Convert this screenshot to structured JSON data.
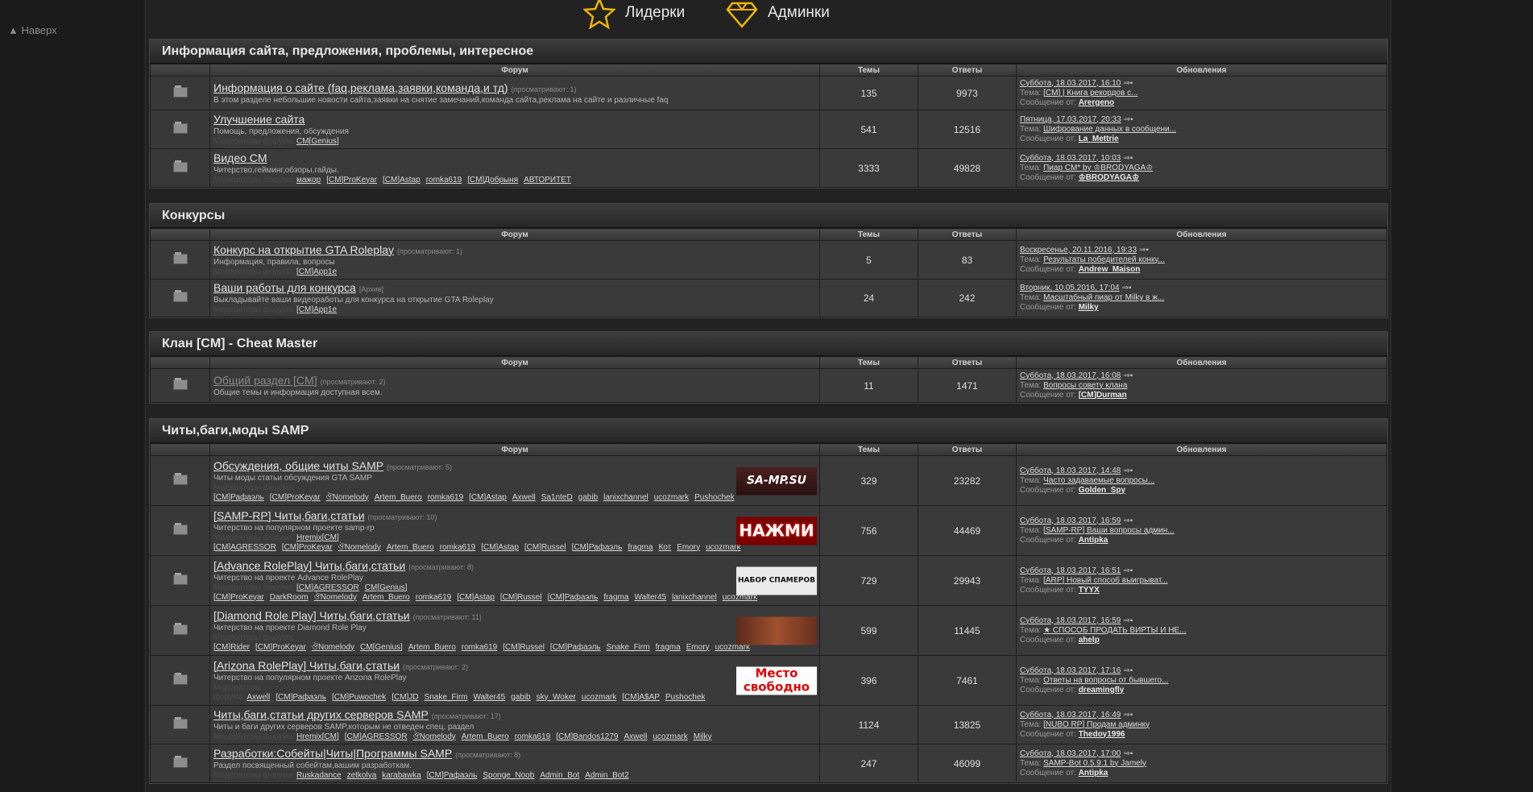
{
  "sidebar": {
    "back_to_top": "▲ Наверх"
  },
  "topnav": {
    "leaders": "Лидерки",
    "admins": "Админки"
  },
  "columns": {
    "forum": "Форум",
    "topics": "Темы",
    "replies": "Ответы",
    "updates": "Обновления"
  },
  "labels": {
    "topic": "Тема:",
    "message_from": "Сообщение от:",
    "moderators": "Модераторы форума:"
  },
  "categories": [
    {
      "title": "Информация сайта, предложения, проблемы, интересное",
      "forums": [
        {
          "title": "Информация о сайте (faq,реклама,заявки,команда,и тд)",
          "viewers": "(просматривают: 1)",
          "desc": "В этом разделе небольшие новости сайта,заявки на снятие замечаний,команда сайта,реклама на сайте и различные faq",
          "mods": [],
          "topics": "135",
          "replies": "9973",
          "date": "Суббота, 18.03.2017, 16:10",
          "topic": "[CM] | Книга рекордов с...",
          "user": "Arergeno"
        },
        {
          "title": "Улучшение сайта",
          "viewers": "",
          "desc": "Помощь, предложения, обсуждения",
          "mods": [
            "CM[Genius]"
          ],
          "topics": "541",
          "replies": "12516",
          "date": "Пятница, 17.03.2017, 20:33",
          "topic": "Шифрование данных в сообщени...",
          "user": "La_Mettrie"
        },
        {
          "title": "Видео CM",
          "viewers": "",
          "desc": "Читерство,гейминг,обзоры,гайды.",
          "mods": [
            "мажор",
            "[CM]ProKeyar",
            "[CM]Astap",
            "romka619",
            "[CM]Добрыня",
            "АВТОРИТЕТ"
          ],
          "topics": "3333",
          "replies": "49828",
          "date": "Суббота, 18.03.2017, 10:03",
          "topic": "Пиар CM* by ♔BRODYAGA♔",
          "user": "♔BRODYAGA♔"
        }
      ]
    },
    {
      "title": "Конкурсы",
      "forums": [
        {
          "title": "Конкурс на открытие GTA Roleplay",
          "viewers": "(просматривают: 1)",
          "desc": "Информация, правила, вопросы",
          "mods": [
            "[CM]App1e"
          ],
          "topics": "5",
          "replies": "83",
          "date": "Воскресенье, 20.11.2016, 19:33",
          "topic": "Результаты победителей конку...",
          "user": "Andrew_Maison"
        },
        {
          "title": "Ваши работы для конкурса",
          "viewers": "[Архив]",
          "desc": "Выкладывайте ваши видеоработы для конкурса на открытие GTA Roleplay",
          "mods": [
            "[CM]App1e"
          ],
          "topics": "24",
          "replies": "242",
          "date": "Вторник, 10.05.2016, 17:04",
          "topic": "Масштабный пиар от Milky в ж...",
          "user": "Milky"
        }
      ]
    },
    {
      "title": "Клан [CM] - Cheat Master",
      "forums": [
        {
          "title": "Общий раздел [CM]",
          "dim": true,
          "viewers": "(просматривают: 2)",
          "desc": "Общие темы и информация доступная всем.",
          "mods": [],
          "topics": "11",
          "replies": "1471",
          "date": "Суббота, 18.03.2017, 16:08",
          "topic": "Вопросы совету клана",
          "user": "[CM]Durman"
        }
      ]
    },
    {
      "title": "Читы,баги,моды SAMP",
      "forums": [
        {
          "title": "Обсуждения, общие читы SAMP",
          "viewers": "(просматривают: 5)",
          "desc": "Читы моды статьи обсуждения GTA SAMP",
          "mods": [
            "[CM]Рафаэль",
            "[CM]ProKeyar",
            "ঔNomelody",
            "Artem_Buero",
            "romka619",
            "[CM]Astap",
            "Axwell",
            "Sa1nteD",
            "gabib",
            "lanixchannel",
            "ucozmark",
            "Pushochek"
          ],
          "banner": "SA-MP.SU",
          "bclass": "b1",
          "topics": "329",
          "replies": "23282",
          "date": "Суббота, 18.03.2017, 14:48",
          "topic": "Часто задаваемые вопросы...",
          "user": "Golden_Spy"
        },
        {
          "title": "[SAMP-RP] Читы,баги,статьи",
          "viewers": "(просматривают: 10)",
          "desc": "Читерство на популярном проекте samp-rp",
          "mods": [
            "Hremix[CM]",
            "[CM]AGRESSOR",
            "[CM]ProKeyar",
            "ঔNomelody",
            "Artem_Buero",
            "romka619",
            "[CM]Astap",
            "[CM]Russel",
            "[CM]Рафаэль",
            "fragma",
            "Кот",
            "Emory",
            "ucozmark"
          ],
          "banner": "НАЖМИ",
          "bclass": "b2",
          "topics": "756",
          "replies": "44469",
          "date": "Суббота, 18.03.2017, 16:59",
          "topic": "[SAMP-RP] Ваши вопросы админ...",
          "user": "Antipka"
        },
        {
          "title": "[Advance RolePlay] Читы,баги,статьи",
          "viewers": "(просматривают: 8)",
          "desc": "Читерство на проекте Advance RolePlay",
          "mods": [
            "[CM]AGRESSOR",
            "CM[Genius]",
            "[CM]ProKeyar",
            "DarkRoom",
            "ঔNomelody",
            "Artem_Buero",
            "romka619",
            "[CM]Astap",
            "[CM]Russel",
            "[CM]Рафаэль",
            "fragma",
            "Walter45",
            "lanixchannel",
            "ucozmark"
          ],
          "banner": "НАБОР СПАМЕРОВ",
          "bclass": "b3",
          "topics": "729",
          "replies": "29943",
          "date": "Суббота, 18.03.2017, 16:51",
          "topic": "[ARP] Новый способ выигрыват...",
          "user": "TYYX"
        },
        {
          "title": "[Diamond Role Play] Читы,баги,статьи",
          "viewers": "(просматривают: 11)",
          "desc": "Читерство на проекте Diamond Role Play",
          "mods": [
            "[CM]Rider",
            "[CM]ProKeyar",
            "ঔNomelody",
            "CM[Genius]",
            "Artem_Buero",
            "romka619",
            "[CM]Russel",
            "[CM]Рафаэль",
            "Snake_Firm",
            "fragma",
            "Emory",
            "ucozmark"
          ],
          "banner": "",
          "bclass": "b4",
          "topics": "599",
          "replies": "11445",
          "date": "Суббота, 18.03.2017, 16:59",
          "topic": "★ СПОСОБ ПРОДАТЬ ВИРТЫ И НЕ...",
          "user": "ahelp"
        },
        {
          "title": "[Arizona RolePlay] Читы,баги,статьи",
          "viewers": "(просматривают: 2)",
          "desc": "Читерство на популярном проекте Arizona RolePlay",
          "mods": [
            "Axwell",
            "[CM]Рафаэль",
            "[CM]Puwochek",
            "[CM]JD",
            "Snake_Firm",
            "Walter45",
            "gabib",
            "sky_Woker",
            "ucozmark",
            "[CM]A$AP",
            "Pushochek"
          ],
          "banner": "Место свободно",
          "bclass": "b5",
          "topics": "396",
          "replies": "7461",
          "date": "Суббота, 18.03.2017, 17:16",
          "topic": "Ответы на вопросы от бывшего...",
          "user": "dreamingfly"
        },
        {
          "title": "Читы,баги,статьи других серверов SAMP",
          "viewers": "(просматривают: 17)",
          "desc": "Читы и баги других серверов SAMP,которым не отведен спец. раздел",
          "mods": [
            "Hremix[CM]",
            "[CM]AGRESSOR",
            "ঔNomelody",
            "Artem_Buero",
            "romka619",
            "[CM]Bandos1279",
            "Axwell",
            "ucozmark",
            "Milky"
          ],
          "topics": "1124",
          "replies": "13825",
          "date": "Суббота, 18.03.2017, 16:49",
          "topic": "[NUBO RP] Продам админку",
          "user": "Thedoy1996"
        },
        {
          "title": "Разработки:Собейты|Читы|Программы SAMP",
          "viewers": "(просматривают: 8)",
          "desc": "Раздел посвященный собейтам,вашим разработкам.",
          "mods": [
            "Ruskadance",
            "zetkolya",
            "karabawka",
            "[CM]Рафаэль",
            "Sponge_Noob",
            "Admin_Bot",
            "Admin_Bot2"
          ],
          "topics": "247",
          "replies": "46099",
          "date": "Суббота, 18.03.2017, 17:00",
          "topic": "SAMP-Bot 0.5.9.1 by Jamely",
          "user": "Antipka"
        }
      ]
    }
  ],
  "colors": {
    "background": "#1e1e1e",
    "cell": "#3a3a3a",
    "header": "#2d2d2d",
    "accent": "#f0b400"
  }
}
